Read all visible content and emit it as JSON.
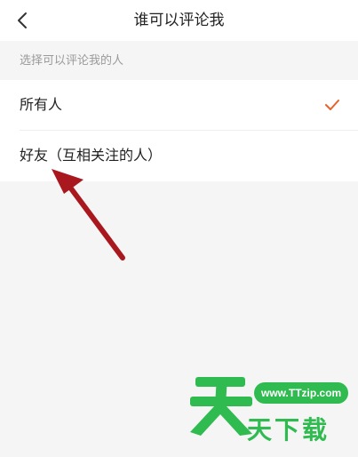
{
  "header": {
    "title": "谁可以评论我",
    "back_icon": "chevron-left-icon"
  },
  "section": {
    "label": "选择可以评论我的人"
  },
  "options": [
    {
      "label": "所有人",
      "selected": true
    },
    {
      "label": "好友（互相关注的人）",
      "selected": false
    }
  ],
  "colors": {
    "accent": "#e8612a",
    "annotation": "#a8181e",
    "watermark": "#2fbb4f"
  },
  "watermark": {
    "url": "www.TTzip.com",
    "text": "天下载"
  }
}
